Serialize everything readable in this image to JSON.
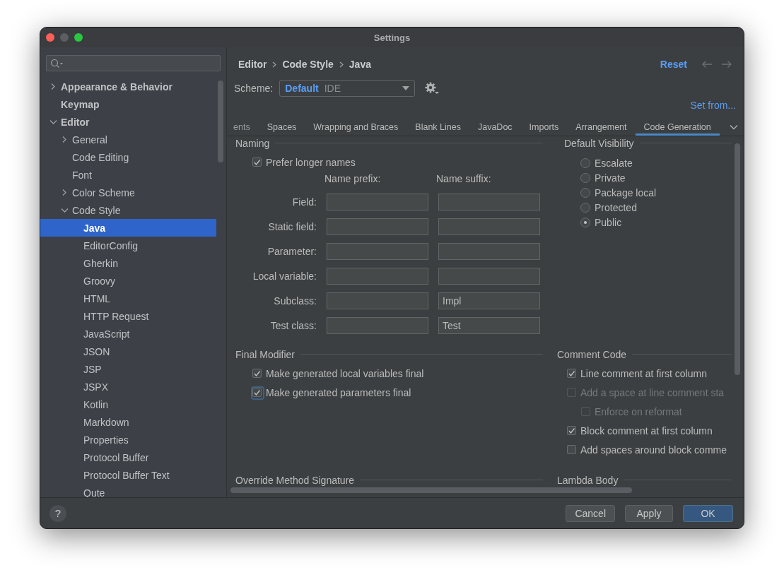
{
  "window": {
    "title": "Settings"
  },
  "sidebar": {
    "items": [
      {
        "label": "Appearance & Behavior",
        "expanded": false
      },
      {
        "label": "Keymap"
      },
      {
        "label": "Editor",
        "expanded": true,
        "children": [
          {
            "label": "General",
            "expanded": false
          },
          {
            "label": "Code Editing"
          },
          {
            "label": "Font"
          },
          {
            "label": "Color Scheme",
            "expanded": false
          },
          {
            "label": "Code Style",
            "expanded": true,
            "children": [
              {
                "label": "Java",
                "selected": true
              },
              {
                "label": "EditorConfig",
                "selected": false
              },
              {
                "label": "Gherkin",
                "selected": false
              },
              {
                "label": "Groovy",
                "selected": false
              },
              {
                "label": "HTML",
                "selected": false
              },
              {
                "label": "HTTP Request",
                "selected": false
              },
              {
                "label": "JavaScript",
                "selected": false
              },
              {
                "label": "JSON",
                "selected": false
              },
              {
                "label": "JSP",
                "selected": false
              },
              {
                "label": "JSPX",
                "selected": false
              },
              {
                "label": "Kotlin",
                "selected": false
              },
              {
                "label": "Markdown",
                "selected": false
              },
              {
                "label": "Properties",
                "selected": false
              },
              {
                "label": "Protocol Buffer",
                "selected": false
              },
              {
                "label": "Protocol Buffer Text",
                "selected": false
              },
              {
                "label": "Qute",
                "selected": false
              }
            ]
          }
        ]
      }
    ]
  },
  "breadcrumb": [
    "Editor",
    "Code Style",
    "Java"
  ],
  "reset": "Reset",
  "scheme": {
    "label": "Scheme:",
    "name": "Default",
    "type": "IDE"
  },
  "set_from": "Set from...",
  "tabs": [
    {
      "label": "ents",
      "selected": false
    },
    {
      "label": "Spaces",
      "selected": false
    },
    {
      "label": "Wrapping and Braces",
      "selected": false
    },
    {
      "label": "Blank Lines",
      "selected": false
    },
    {
      "label": "JavaDoc",
      "selected": false
    },
    {
      "label": "Imports",
      "selected": false
    },
    {
      "label": "Arrangement",
      "selected": false
    },
    {
      "label": "Code Generation",
      "selected": true
    }
  ],
  "naming": {
    "title": "Naming",
    "prefer_longer": {
      "label": "Prefer longer names",
      "checked": true
    },
    "headers": [
      "Name prefix:",
      "Name suffix:"
    ],
    "rows": [
      {
        "label": "Field:"
      },
      {
        "label": "Static field:"
      },
      {
        "label": "Parameter:"
      },
      {
        "label": "Local variable:"
      },
      {
        "label": "Subclass:",
        "suffix": "Impl"
      },
      {
        "label": "Test class:",
        "suffix": "Test"
      }
    ]
  },
  "default_visibility": {
    "title": "Default Visibility",
    "options": [
      {
        "label": "Escalate",
        "selected": false
      },
      {
        "label": "Private",
        "selected": false
      },
      {
        "label": "Package local",
        "selected": false
      },
      {
        "label": "Protected",
        "selected": false
      },
      {
        "label": "Public",
        "selected": true
      }
    ]
  },
  "final_modifier": {
    "title": "Final Modifier",
    "options": [
      {
        "label": "Make generated local variables final",
        "checked": true,
        "focused": false
      },
      {
        "label": "Make generated parameters final",
        "checked": true,
        "focused": true
      }
    ]
  },
  "comment_code": {
    "title": "Comment Code",
    "options": [
      {
        "label": "Line comment at first column",
        "checked": true,
        "disabled": false
      },
      {
        "label": "Add a space at line comment sta",
        "checked": false,
        "disabled": true,
        "children": [
          {
            "label": "Enforce on reformat",
            "checked": false,
            "disabled": true
          }
        ]
      },
      {
        "label": "Block comment at first column",
        "checked": true,
        "disabled": false
      },
      {
        "label": "Add spaces around block comme",
        "checked": false,
        "disabled": false
      }
    ]
  },
  "override_method_signature": {
    "title": "Override Method Signature"
  },
  "lambda_body": {
    "title": "Lambda Body"
  },
  "help": "?",
  "buttons": [
    {
      "label": "Cancel",
      "default": false
    },
    {
      "label": "Apply",
      "default": false
    },
    {
      "label": "OK",
      "default": true
    }
  ]
}
